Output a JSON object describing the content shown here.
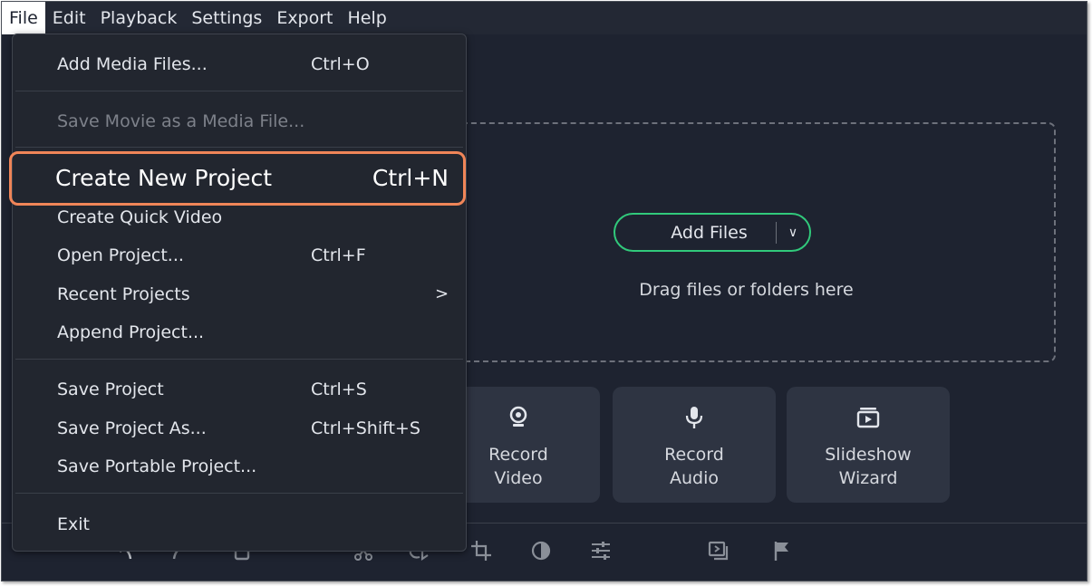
{
  "menubar": [
    {
      "label": "File",
      "active": true
    },
    {
      "label": "Edit"
    },
    {
      "label": "Playback"
    },
    {
      "label": "Settings"
    },
    {
      "label": "Export"
    },
    {
      "label": "Help"
    }
  ],
  "file_menu": {
    "add_media": {
      "label": "Add Media Files...",
      "shortcut": "Ctrl+O"
    },
    "save_movie": {
      "label": "Save Movie as a Media File..."
    },
    "create_new": {
      "label": "Create New Project",
      "shortcut": "Ctrl+N"
    },
    "quick_video": {
      "label": "Create Quick Video"
    },
    "open_project": {
      "label": "Open Project...",
      "shortcut": "Ctrl+F"
    },
    "recent_projects": {
      "label": "Recent Projects",
      "arrow": ">"
    },
    "append_project": {
      "label": "Append Project..."
    },
    "save_project": {
      "label": "Save Project",
      "shortcut": "Ctrl+S"
    },
    "save_project_as": {
      "label": "Save Project As...",
      "shortcut": "Ctrl+Shift+S"
    },
    "save_portable": {
      "label": "Save Portable Project..."
    },
    "exit": {
      "label": "Exit"
    }
  },
  "dropzone": {
    "add_files_label": "Add Files",
    "add_files_chevron": "∨",
    "hint": "Drag files or folders here"
  },
  "tiles": {
    "record_video": {
      "line1": "Record",
      "line2": "Video",
      "icon": "webcam-icon"
    },
    "record_audio": {
      "line1": "Record",
      "line2": "Audio",
      "icon": "microphone-icon"
    },
    "slideshow": {
      "line1": "Slideshow",
      "line2": "Wizard",
      "icon": "slideshow-icon"
    }
  },
  "toolbar_icons": [
    "undo-icon",
    "redo-icon",
    "delete-icon",
    "cut-icon",
    "rotate-icon",
    "crop-icon",
    "color-adjust-icon",
    "equalizer-icon",
    "transition-icon",
    "marker-flag-icon"
  ],
  "colors": {
    "background": "#1e2330",
    "menu_background": "#22262f",
    "accent_green": "#31c97b",
    "highlight_orange": "#f08558",
    "tile_background": "#2e3442"
  }
}
